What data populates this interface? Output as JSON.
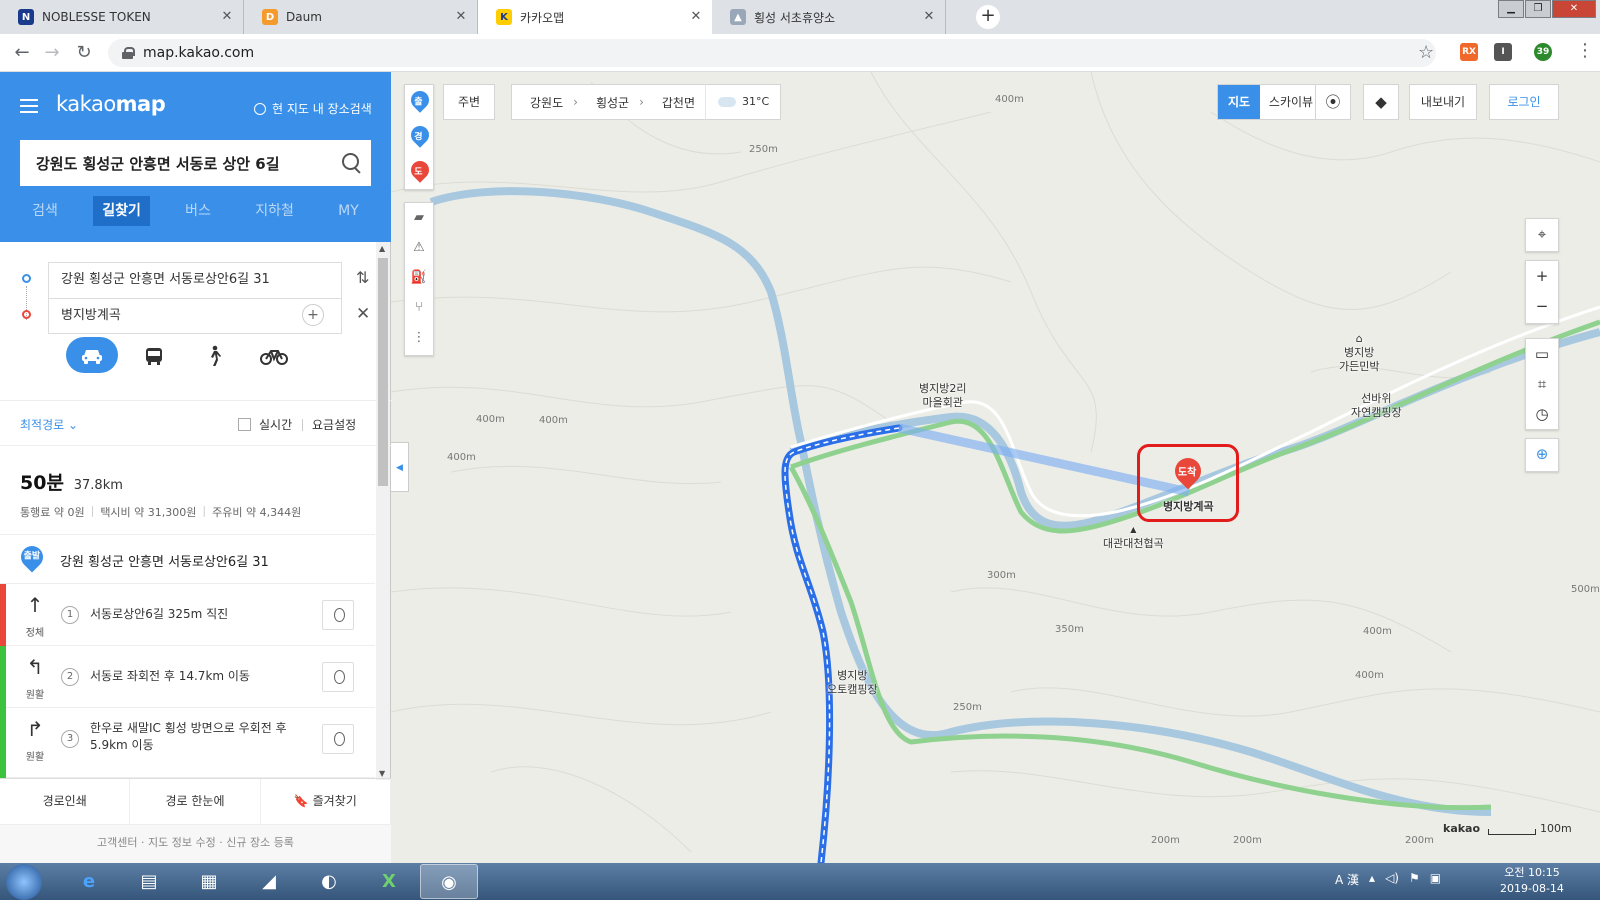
{
  "browser": {
    "tabs": [
      {
        "title": "NOBLESSE TOKEN",
        "favicon": "N",
        "color": "#1a3a8c"
      },
      {
        "title": "Daum",
        "favicon": "D",
        "color": "#f59b2d"
      },
      {
        "title": "카카오맵",
        "favicon": "K",
        "color": "#ffcd00"
      },
      {
        "title": "횡성 서초휴양소",
        "favicon": "▲",
        "color": "#9aa7b8"
      }
    ],
    "url": "map.kakao.com",
    "extension_badge": "39"
  },
  "sidebar": {
    "brand_a": "kakao",
    "brand_b": "map",
    "here_search": "현 지도 내 장소검색",
    "search_value": "강원도 횡성군 안흥면 서동로 상안 6길",
    "tabs": [
      "검색",
      "길찾기",
      "버스",
      "지하철",
      "MY"
    ],
    "origin": "강원 횡성군 안흥면 서동로상안6길 31",
    "destination": "병지방계곡",
    "option_best": "최적경로 ⌄",
    "option_realtime": "실시간",
    "option_fee": "요금설정",
    "time": "50분",
    "distance": "37.8km",
    "fee_toll": "통행료 약 0원",
    "fee_taxi": "택시비 약 31,300원",
    "fee_fuel": "주유비 약 4,344원",
    "start_badge": "출발",
    "start_text": "강원 횡성군 안흥면 서동로상안6길 31",
    "steps": [
      {
        "num": "1",
        "text": "서동로상안6길 325m 직진",
        "label": "정체",
        "arrow": "↑",
        "color": "#e9473a"
      },
      {
        "num": "2",
        "text": "서동로 좌회전 후 14.7km 이동",
        "label": "원활",
        "arrow": "↰",
        "color": "#3cc23c"
      },
      {
        "num": "3",
        "text": "한우로 새말IC 횡성 방면으로 우회전 후 5.9km 이동",
        "label": "원활",
        "arrow": "↱",
        "color": "#3cc23c"
      }
    ],
    "footer": [
      "경로인쇄",
      "경로 한눈에",
      "즐겨찾기"
    ],
    "links": "고객센터 · 지도 정보 수정 · 신규 장소 등록"
  },
  "map": {
    "tool_pins": [
      "출",
      "경",
      "도"
    ],
    "nearby": "주변",
    "crumbs": [
      "강원도",
      "횡성군",
      "갑천면"
    ],
    "weather": "31°C",
    "type_map": "지도",
    "type_sky": "스카이뷰",
    "export": "내보내기",
    "login": "로그인",
    "places": {
      "hall": "병지방2리\n마을회관",
      "minbak": "병지방\n가든민박",
      "camp1": "선바위\n자연캠핑장",
      "camp2": "병지방\n오토캠핑장",
      "gorge": "대관대천협곡",
      "dest": "병지방계곡"
    },
    "dest_badge": "도착",
    "contours": [
      "400m",
      "250m",
      "400m",
      "400m",
      "400m",
      "300m",
      "350m",
      "400m",
      "400m",
      "250m",
      "500m",
      "200m",
      "200m",
      "200m"
    ],
    "scale_brand": "kakao",
    "scale_text": "100m"
  },
  "taskbar": {
    "time": "오전 10:15",
    "date": "2019-08-14",
    "ime": "A 漢"
  },
  "colors": {
    "kakao_blue": "#3a90e8",
    "route_blue": "#2a6ee8",
    "highlight_red": "#e21b1b",
    "river": "#a8c8e0",
    "road_green": "#8fd18f"
  }
}
